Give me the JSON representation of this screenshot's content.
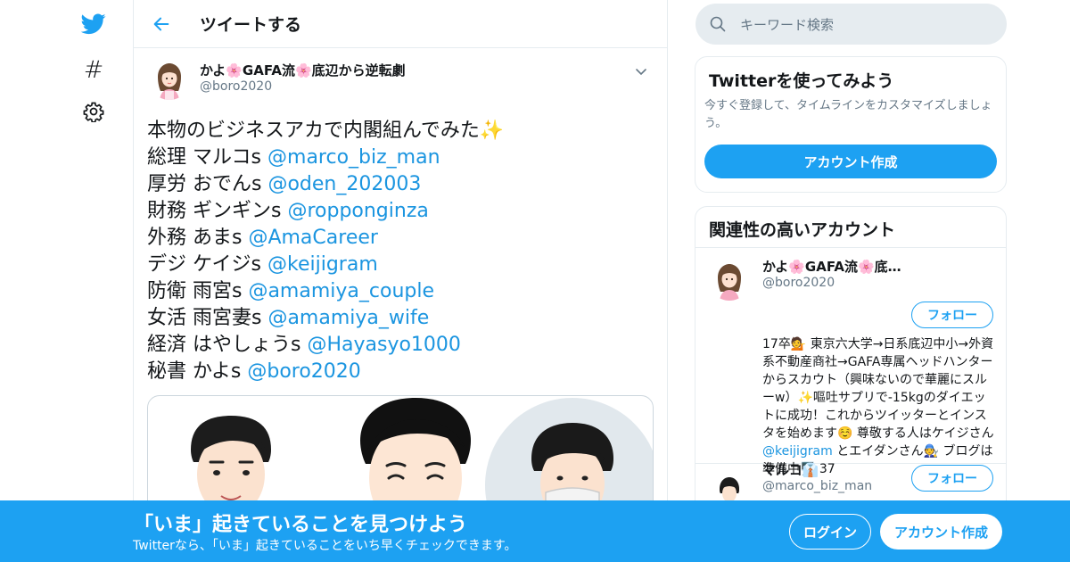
{
  "nav": {
    "items": [
      {
        "icon": "twitter-bird-icon"
      },
      {
        "icon": "hashtag-icon",
        "glyph": "#"
      },
      {
        "icon": "gear-icon"
      }
    ]
  },
  "header": {
    "title": "ツイートする"
  },
  "tweet": {
    "author_name": "かよ🌸GAFA流🌸底辺から逆転劇",
    "author_handle": "@boro2020",
    "intro": "本物のビジネスアカで内閣組んでみた✨",
    "lines": [
      {
        "role": "総理 マルコs ",
        "mention": "@marco_biz_man"
      },
      {
        "role": "厚労 おでんs ",
        "mention": "@oden_202003"
      },
      {
        "role": "財務 ギンギンs ",
        "mention": "@ropponginza"
      },
      {
        "role": "外務 あまs ",
        "mention": "@AmaCareer"
      },
      {
        "role": "デジ ケイジs ",
        "mention": "@keijigram"
      },
      {
        "role": "防衛 雨宮s ",
        "mention": "@amamiya_couple"
      },
      {
        "role": "女活 雨宮妻s ",
        "mention": "@amamiya_wife"
      },
      {
        "role": "経済 はやしょうs ",
        "mention": "@Hayasyo1000"
      },
      {
        "role": "秘書 かよs ",
        "mention": "@boro2020"
      }
    ]
  },
  "search": {
    "placeholder": "キーワード検索"
  },
  "signup_card": {
    "title": "Twitterを使ってみよう",
    "desc": "今すぐ登録して、タイムラインをカスタマイズしましょう。",
    "button": "アカウント作成"
  },
  "related": {
    "title": "関連性の高いアカウント",
    "accounts": [
      {
        "name": "かよ🌸GAFA流🌸底…",
        "handle": "@boro2020",
        "follow": "フォロー",
        "bio_before": "17卒💁 東京六大学→日系底辺中小→外資系不動産商社→GAFA専属ヘッドハンターからスカウト（興味ないので華麗にスルーw）✨嘔吐サプリで-15kgのダイエットに成功！これからツイッターとインスタを始めます☺️ 尊敬する人はケイジさん",
        "bio_mention": "@keijigram",
        "bio_after": " とエイダンさん🧑‍🔧 ブログは準備中🖥️ 37"
      },
      {
        "name": "マルコ👔",
        "handle": "@marco_biz_man",
        "follow": "フォロー"
      }
    ]
  },
  "bottom_bar": {
    "title": "「いま」起きていることを見つけよう",
    "subtitle": "Twitterなら、「いま」起きていることをいち早くチェックできます。",
    "login": "ログイン",
    "signup": "アカウント作成"
  },
  "colors": {
    "accent": "#1da1f2",
    "link": "#1b95e0",
    "muted": "#657786",
    "border": "#e6ecf0"
  }
}
